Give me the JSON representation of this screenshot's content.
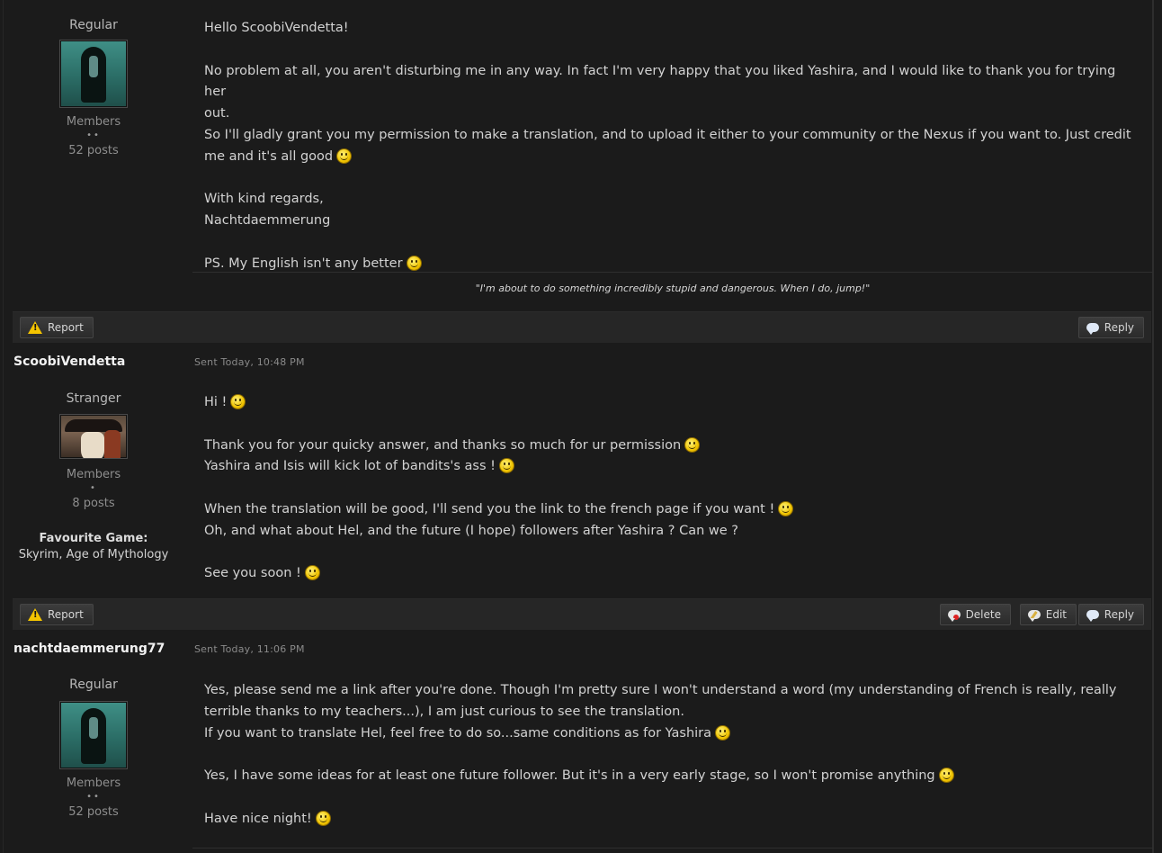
{
  "posts": [
    {
      "rank": "Regular",
      "avatar": "ring-girl-avatar",
      "group": "Members",
      "pips": "••",
      "posts": "52 posts",
      "lines": [
        "Hello ScoobiVendetta!",
        "",
        "No problem at all, you aren't disturbing me in any way. In fact I'm very happy that you liked Yashira, and I would like to thank you for trying her",
        "out.",
        "So I'll gladly grant you my permission to make a translation, and to upload it either to your community or the Nexus if you want to. Just credit",
        "me and it's all good",
        "",
        "With kind regards,",
        "Nachtdaemmerung",
        "",
        "PS. My English isn't any better"
      ],
      "signature": "\"I'm about to do something incredibly stupid and dangerous. When I do, jump!\"",
      "actions": {
        "report": "Report",
        "reply": "Reply"
      }
    },
    {
      "username": "ScoobiVendetta",
      "date": "Sent Today, 10:48 PM",
      "rank": "Stranger",
      "avatar": "vendetta-mask-avatar",
      "group": "Members",
      "pips": "•",
      "posts": "8 posts",
      "fav_label": "Favourite Game:",
      "fav_value": "Skyrim, Age of Mythology",
      "lines": [
        "Hi !",
        "",
        "Thank you for your quicky answer, and thanks so much for ur permission",
        "Yashira and Isis will kick lot of bandits's ass !",
        "",
        "When the translation will be good, I'll send you the link to the french page if you want !",
        "Oh, and what about Hel, and the future (I hope) followers after Yashira ? Can we ?",
        "",
        "See you soon !"
      ],
      "actions": {
        "report": "Report",
        "delete": "Delete",
        "edit": "Edit",
        "reply": "Reply"
      }
    },
    {
      "username": "nachtdaemmerung77",
      "date": "Sent Today, 11:06 PM",
      "rank": "Regular",
      "avatar": "ring-girl-avatar",
      "group": "Members",
      "pips": "••",
      "posts": "52 posts",
      "lines": [
        "Yes, please send me a link after you're done. Though I'm pretty sure I won't understand a word (my understanding of French is really, really",
        "terrible thanks to my teachers...), I am just curious to see the translation.",
        "If you want to translate Hel, feel free to do so...same conditions as for Yashira",
        "",
        "Yes, I have some ideas for at least one future follower. But it's in a very early stage, so I won't promise anything",
        "",
        "Have nice night!"
      ]
    }
  ]
}
